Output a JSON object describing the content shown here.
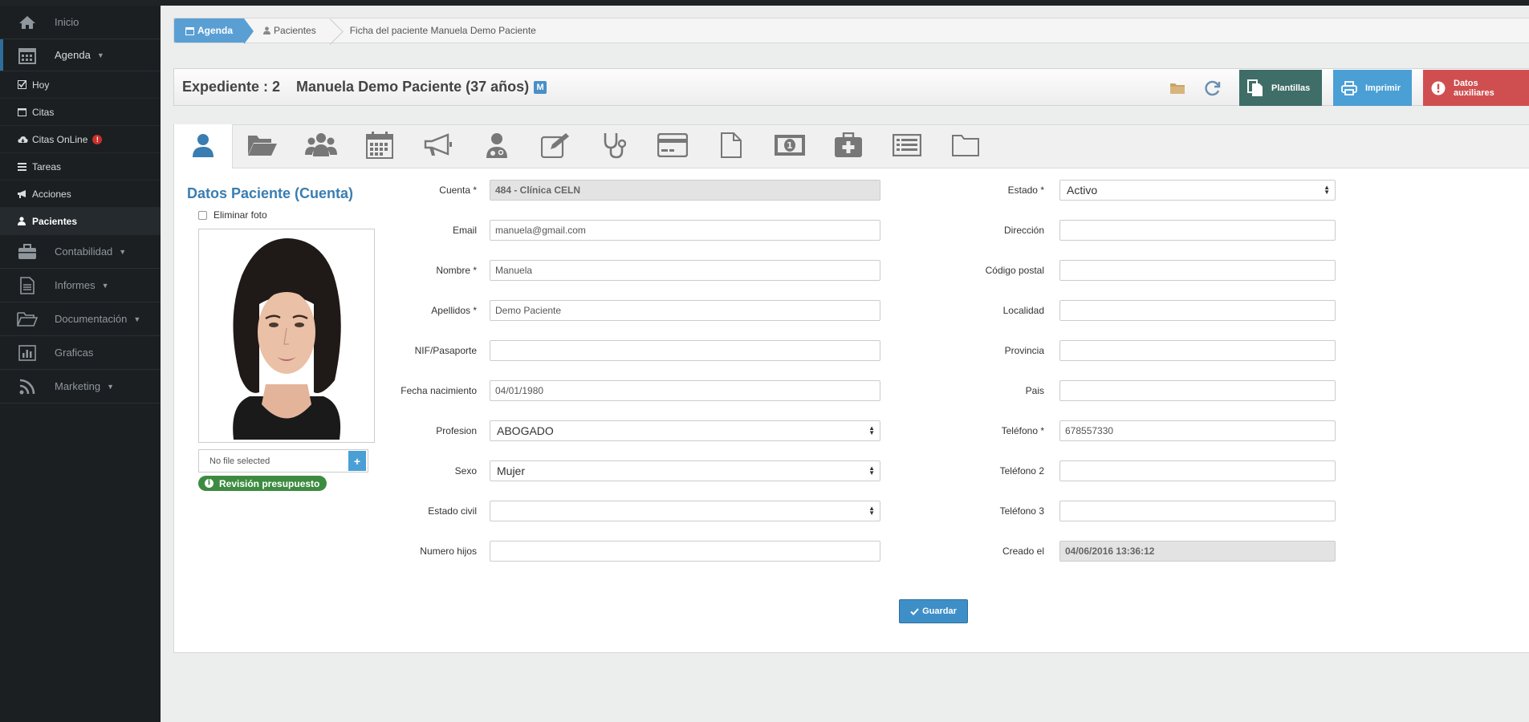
{
  "sidebar": {
    "inicio": "Inicio",
    "agenda": "Agenda",
    "sub": {
      "hoy": "Hoy",
      "citas": "Citas",
      "citas_online": "Citas OnLine",
      "tareas": "Tareas",
      "acciones": "Acciones",
      "pacientes": "Pacientes"
    },
    "contabilidad": "Contabilidad",
    "informes": "Informes",
    "documentacion": "Documentación",
    "graficas": "Graficas",
    "marketing": "Marketing"
  },
  "breadcrumb": {
    "home": "Agenda",
    "mid": "Pacientes",
    "current": "Ficha del paciente Manuela Demo Paciente"
  },
  "header": {
    "expediente": "Expediente : 2",
    "patient": "Manuela Demo Paciente (37 años)",
    "gender_badge": "M",
    "btn_plantillas": "Plantillas",
    "btn_imprimir": "Imprimir",
    "btn_datos": "Datos auxiliares"
  },
  "section_title": "Datos Paciente (Cuenta)",
  "photo": {
    "delete_label": "Eliminar foto",
    "file_text": "No file selected",
    "plus": "+",
    "revision": "Revisión presupuesto"
  },
  "form_left": {
    "cuenta_label": "Cuenta *",
    "cuenta_value": "484 - Clínica CELN",
    "email_label": "Email",
    "email_value": "manuela@gmail.com",
    "nombre_label": "Nombre *",
    "nombre_value": "Manuela",
    "apellidos_label": "Apellidos *",
    "apellidos_value": "Demo Paciente",
    "nif_label": "NIF/Pasaporte",
    "nif_value": "",
    "fecha_label": "Fecha nacimiento",
    "fecha_value": "04/01/1980",
    "profesion_label": "Profesion",
    "profesion_value": "ABOGADO",
    "sexo_label": "Sexo",
    "sexo_value": "Mujer",
    "estado_civil_label": "Estado civil",
    "estado_civil_value": "",
    "hijos_label": "Numero hijos",
    "hijos_value": ""
  },
  "form_right": {
    "estado_label": "Estado *",
    "estado_value": "Activo",
    "direccion_label": "Dirección",
    "cp_label": "Código postal",
    "localidad_label": "Localidad",
    "provincia_label": "Provincia",
    "pais_label": "Pais",
    "telefono_label": "Teléfono *",
    "telefono_value": "678557330",
    "telefono2_label": "Teléfono 2",
    "telefono3_label": "Teléfono 3",
    "creado_label": "Creado el",
    "creado_value": "04/06/2016 13:36:12"
  },
  "save_label": "Guardar",
  "colors": {
    "sidebar_bg": "#1b1f22",
    "accent": "#3a7db1",
    "plantillas": "#3f6d68",
    "imprimir": "#4a9fd5",
    "datos": "#cf4f50",
    "badge_green": "#3d8b40"
  }
}
